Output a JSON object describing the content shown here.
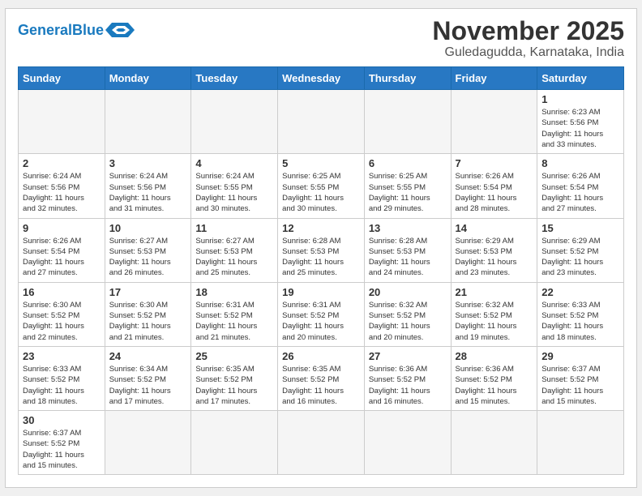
{
  "header": {
    "logo_general": "General",
    "logo_blue": "Blue",
    "month_title": "November 2025",
    "location": "Guledagudda, Karnataka, India"
  },
  "days_of_week": [
    "Sunday",
    "Monday",
    "Tuesday",
    "Wednesday",
    "Thursday",
    "Friday",
    "Saturday"
  ],
  "weeks": [
    [
      {
        "day": "",
        "info": ""
      },
      {
        "day": "",
        "info": ""
      },
      {
        "day": "",
        "info": ""
      },
      {
        "day": "",
        "info": ""
      },
      {
        "day": "",
        "info": ""
      },
      {
        "day": "",
        "info": ""
      },
      {
        "day": "1",
        "info": "Sunrise: 6:23 AM\nSunset: 5:56 PM\nDaylight: 11 hours\nand 33 minutes."
      }
    ],
    [
      {
        "day": "2",
        "info": "Sunrise: 6:24 AM\nSunset: 5:56 PM\nDaylight: 11 hours\nand 32 minutes."
      },
      {
        "day": "3",
        "info": "Sunrise: 6:24 AM\nSunset: 5:56 PM\nDaylight: 11 hours\nand 31 minutes."
      },
      {
        "day": "4",
        "info": "Sunrise: 6:24 AM\nSunset: 5:55 PM\nDaylight: 11 hours\nand 30 minutes."
      },
      {
        "day": "5",
        "info": "Sunrise: 6:25 AM\nSunset: 5:55 PM\nDaylight: 11 hours\nand 30 minutes."
      },
      {
        "day": "6",
        "info": "Sunrise: 6:25 AM\nSunset: 5:55 PM\nDaylight: 11 hours\nand 29 minutes."
      },
      {
        "day": "7",
        "info": "Sunrise: 6:26 AM\nSunset: 5:54 PM\nDaylight: 11 hours\nand 28 minutes."
      },
      {
        "day": "8",
        "info": "Sunrise: 6:26 AM\nSunset: 5:54 PM\nDaylight: 11 hours\nand 27 minutes."
      }
    ],
    [
      {
        "day": "9",
        "info": "Sunrise: 6:26 AM\nSunset: 5:54 PM\nDaylight: 11 hours\nand 27 minutes."
      },
      {
        "day": "10",
        "info": "Sunrise: 6:27 AM\nSunset: 5:53 PM\nDaylight: 11 hours\nand 26 minutes."
      },
      {
        "day": "11",
        "info": "Sunrise: 6:27 AM\nSunset: 5:53 PM\nDaylight: 11 hours\nand 25 minutes."
      },
      {
        "day": "12",
        "info": "Sunrise: 6:28 AM\nSunset: 5:53 PM\nDaylight: 11 hours\nand 25 minutes."
      },
      {
        "day": "13",
        "info": "Sunrise: 6:28 AM\nSunset: 5:53 PM\nDaylight: 11 hours\nand 24 minutes."
      },
      {
        "day": "14",
        "info": "Sunrise: 6:29 AM\nSunset: 5:53 PM\nDaylight: 11 hours\nand 23 minutes."
      },
      {
        "day": "15",
        "info": "Sunrise: 6:29 AM\nSunset: 5:52 PM\nDaylight: 11 hours\nand 23 minutes."
      }
    ],
    [
      {
        "day": "16",
        "info": "Sunrise: 6:30 AM\nSunset: 5:52 PM\nDaylight: 11 hours\nand 22 minutes."
      },
      {
        "day": "17",
        "info": "Sunrise: 6:30 AM\nSunset: 5:52 PM\nDaylight: 11 hours\nand 21 minutes."
      },
      {
        "day": "18",
        "info": "Sunrise: 6:31 AM\nSunset: 5:52 PM\nDaylight: 11 hours\nand 21 minutes."
      },
      {
        "day": "19",
        "info": "Sunrise: 6:31 AM\nSunset: 5:52 PM\nDaylight: 11 hours\nand 20 minutes."
      },
      {
        "day": "20",
        "info": "Sunrise: 6:32 AM\nSunset: 5:52 PM\nDaylight: 11 hours\nand 20 minutes."
      },
      {
        "day": "21",
        "info": "Sunrise: 6:32 AM\nSunset: 5:52 PM\nDaylight: 11 hours\nand 19 minutes."
      },
      {
        "day": "22",
        "info": "Sunrise: 6:33 AM\nSunset: 5:52 PM\nDaylight: 11 hours\nand 18 minutes."
      }
    ],
    [
      {
        "day": "23",
        "info": "Sunrise: 6:33 AM\nSunset: 5:52 PM\nDaylight: 11 hours\nand 18 minutes."
      },
      {
        "day": "24",
        "info": "Sunrise: 6:34 AM\nSunset: 5:52 PM\nDaylight: 11 hours\nand 17 minutes."
      },
      {
        "day": "25",
        "info": "Sunrise: 6:35 AM\nSunset: 5:52 PM\nDaylight: 11 hours\nand 17 minutes."
      },
      {
        "day": "26",
        "info": "Sunrise: 6:35 AM\nSunset: 5:52 PM\nDaylight: 11 hours\nand 16 minutes."
      },
      {
        "day": "27",
        "info": "Sunrise: 6:36 AM\nSunset: 5:52 PM\nDaylight: 11 hours\nand 16 minutes."
      },
      {
        "day": "28",
        "info": "Sunrise: 6:36 AM\nSunset: 5:52 PM\nDaylight: 11 hours\nand 15 minutes."
      },
      {
        "day": "29",
        "info": "Sunrise: 6:37 AM\nSunset: 5:52 PM\nDaylight: 11 hours\nand 15 minutes."
      }
    ],
    [
      {
        "day": "30",
        "info": "Sunrise: 6:37 AM\nSunset: 5:52 PM\nDaylight: 11 hours\nand 15 minutes."
      },
      {
        "day": "",
        "info": ""
      },
      {
        "day": "",
        "info": ""
      },
      {
        "day": "",
        "info": ""
      },
      {
        "day": "",
        "info": ""
      },
      {
        "day": "",
        "info": ""
      },
      {
        "day": "",
        "info": ""
      }
    ]
  ]
}
